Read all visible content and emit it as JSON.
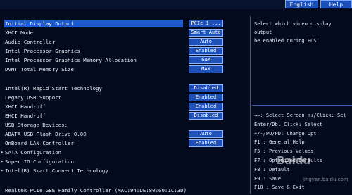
{
  "header": {
    "language_button": "English",
    "help_button": "Help"
  },
  "settings": [
    {
      "label": "Initial Display Output",
      "value": "PCIe 1 ...",
      "selected": true
    },
    {
      "label": "XHCI Mode",
      "value": "Smart Auto"
    },
    {
      "label": "Audio Controller",
      "value": "Auto"
    },
    {
      "label": "Intel Processor Graphics",
      "value": "Enabled"
    },
    {
      "label": "Intel Processor Graphics Memory Allocation",
      "value": "64M"
    },
    {
      "label": "DVMT Total Memory Size",
      "value": "MAX"
    },
    {
      "label": "Intel(R) Rapid Start Technology",
      "value": "Disabled"
    },
    {
      "label": "Legacy USB Support",
      "value": "Enabled"
    },
    {
      "label": "XHCI Hand-off",
      "value": "Enabled"
    },
    {
      "label": "EHCI Hand-off",
      "value": "Disabled"
    },
    {
      "label": "USB Storage Devices:"
    },
    {
      "label": "ADATA USB Flash Drive 0.00",
      "value": "Auto"
    },
    {
      "label": "OnBoard LAN Controller",
      "value": "Enabled"
    },
    {
      "label": "SATA Configuration",
      "submenu": true
    },
    {
      "label": "Super IO Configuration",
      "submenu": true
    },
    {
      "label": "Intel(R) Smart Connect Technology",
      "submenu": true
    },
    {
      "label": "Realtek PCIe GBE Family Controller (MAC:94:DE:80:00:1C:3D)"
    }
  ],
  "help_text": "Select which video display output\nbe enabled during POST",
  "key_help": [
    "→←: Select Screen  ↑↓/Click: Sel",
    "Enter/Dbl Click: Select",
    "+/-/PU/PD: Change Opt.",
    "F1  : General Help",
    "F5  : Previous Values",
    "F7  : Optimized Defaults",
    "F8  : Default",
    "F9  : Save",
    "F10 : Save & Exit"
  ],
  "watermark": "Baidu",
  "watermark_sub": "jingyan.baidu.com",
  "colors": {
    "background": "#050b1f",
    "selected": "#1f59d0",
    "value_box": "#1d50b8"
  }
}
